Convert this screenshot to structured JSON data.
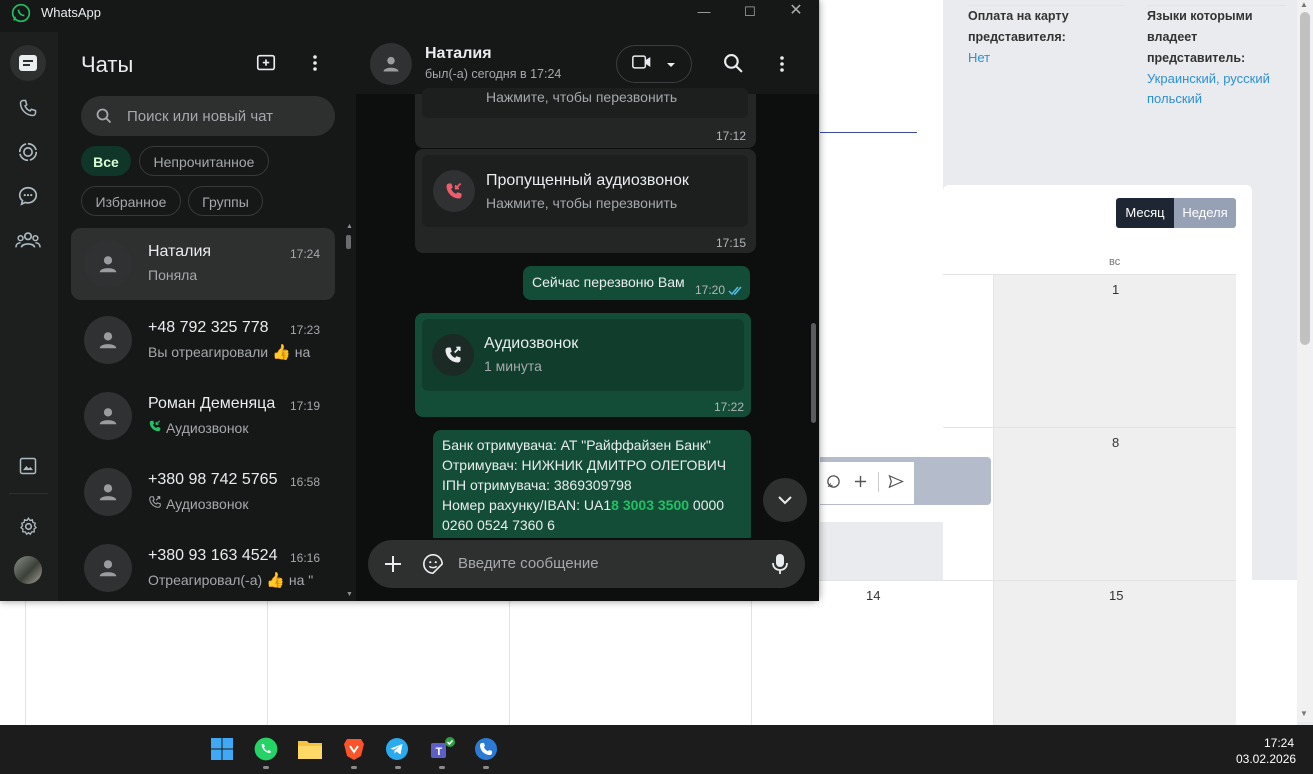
{
  "window": {
    "app_title": "WhatsApp"
  },
  "background_page": {
    "payment_label": "Оплата на карту представителя:",
    "payment_value": "Нет",
    "languages_label": "Языки которыми владеет представитель:",
    "languages_value": "Украинский, русский польский",
    "view_buttons": {
      "month": "Месяц",
      "week": "Неделя"
    },
    "day_header": "вс",
    "dates": {
      "d1": "1",
      "d8": "8",
      "d14": "14",
      "d15": "15"
    }
  },
  "sidebar": {
    "title": "Чаты",
    "search_placeholder": "Поиск или новый чат",
    "filters": [
      "Все",
      "Непрочитанное",
      "Избранное",
      "Группы"
    ],
    "active_filter": "Все"
  },
  "chats": [
    {
      "name": "Наталия",
      "time": "17:24",
      "last": "Поняла",
      "icon": "none",
      "selected": true
    },
    {
      "name": "+48 792 325 778",
      "time": "17:23",
      "last": "Вы отреагировали",
      "suffix": "на",
      "icon": "thumbs-up"
    },
    {
      "name": "Роман Деменяца",
      "time": "17:19",
      "last": "Аудиозвонок",
      "icon": "incoming-call"
    },
    {
      "name": "+380 98 742 5765",
      "time": "16:58",
      "last": "Аудиозвонок",
      "icon": "outgoing-call"
    },
    {
      "name": "+380 93 163 4524",
      "time": "16:16",
      "last": "Отреагировал(-а)",
      "suffix": "на \"",
      "icon": "thumbs-up"
    }
  ],
  "conversation": {
    "contact_name": "Наталия",
    "status": "был(-а) сегодня в 17:24",
    "messages": {
      "m0": {
        "sub": "Нажмите, чтобы перезвонить",
        "time": "17:12"
      },
      "m1": {
        "title": "Пропущенный аудиозвонок",
        "sub": "Нажмите, чтобы перезвонить",
        "time": "17:15"
      },
      "m2": {
        "text": "Сейчас перезвоню Вам",
        "time": "17:20"
      },
      "m3": {
        "title": "Аудиозвонок",
        "sub": "1 минута",
        "time": "17:22"
      },
      "m4": {
        "line1": "Банк отримувача: АТ \"Райффайзен Банк\"",
        "line2": "Отримувач: НИЖНИК ДМИТРО ОЛЕГОВИЧ",
        "line3": "ІПН отримувача: 3869309798",
        "line4_a": "Номер рахунку/IBAN: UA1",
        "line4_b": "8 3003 3500",
        "line4_c": " 0000",
        "line5": "0260 0524 7360 6"
      }
    },
    "composer_placeholder": "Введите сообщение"
  },
  "taskbar": {
    "time": "17:24",
    "date": "03.02.2026"
  },
  "colors": {
    "accent_green": "#21c063",
    "outgoing_bubble": "#144d37",
    "incoming_bubble": "#242626",
    "missed_call_red": "#f15c6d",
    "link_blue": "#53bdeb"
  }
}
